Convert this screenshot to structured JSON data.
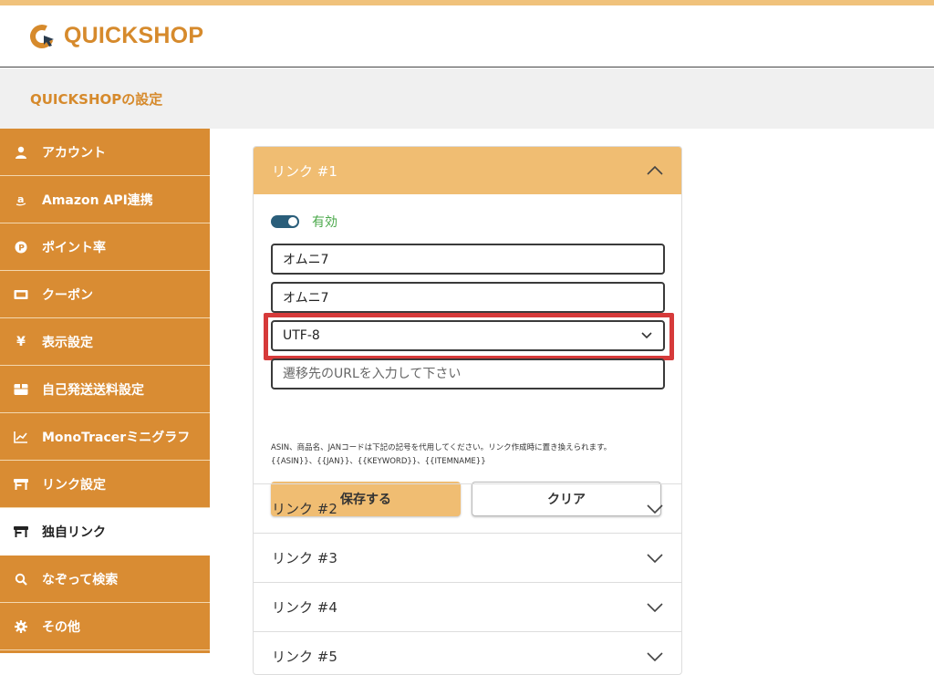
{
  "brand": {
    "name": "QUICKSHOP",
    "color": "#d68a2c"
  },
  "subheader": {
    "title": "QUICKSHOPの設定"
  },
  "sidebar": {
    "items": [
      {
        "label": "アカウント",
        "icon": "user-icon"
      },
      {
        "label": "Amazon API連携",
        "icon": "amazon-icon"
      },
      {
        "label": "ポイント率",
        "icon": "points-icon"
      },
      {
        "label": "クーポン",
        "icon": "ticket-icon"
      },
      {
        "label": "表示設定",
        "icon": "yen-icon"
      },
      {
        "label": "自己発送送料設定",
        "icon": "box-icon"
      },
      {
        "label": "MonoTracerミニグラフ",
        "icon": "chart-icon"
      },
      {
        "label": "リンク設定",
        "icon": "store-icon"
      },
      {
        "label": "独自リンク",
        "icon": "store-icon",
        "active": true
      },
      {
        "label": "なぞって検索",
        "icon": "search-icon"
      },
      {
        "label": "その他",
        "icon": "gear-icon"
      }
    ]
  },
  "link1": {
    "title": "リンク #1",
    "toggle_label": "有効",
    "field1_value": "オムニ7",
    "field2_value": "オムニ7",
    "encoding_value": "UTF-8",
    "url_placeholder": "遷移先のURLを入力して下さい",
    "help_line1": "ASIN、商品名、JANコードは下記の記号を代用してください。リンク作成時に置き換えられます。",
    "help_line2": "{{ASIN}}、{{JAN}}、{{KEYWORD}}、{{ITEMNAME}}",
    "save_label": "保存する",
    "clear_label": "クリア"
  },
  "links": [
    {
      "title": "リンク #2"
    },
    {
      "title": "リンク #3"
    },
    {
      "title": "リンク #4"
    },
    {
      "title": "リンク #5"
    }
  ],
  "colors": {
    "accent": "#d98c33",
    "accent_light": "#f0bd72",
    "toggle": "#2a5e7a",
    "highlight": "#d63a3a"
  }
}
